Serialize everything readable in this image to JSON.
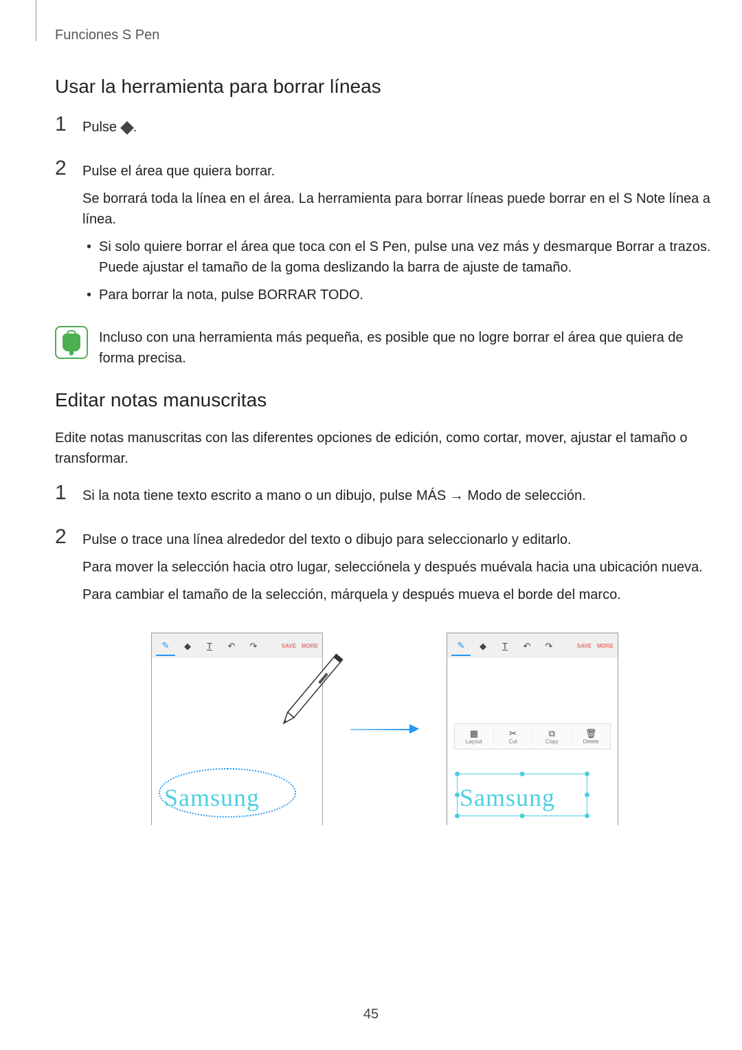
{
  "header": {
    "breadcrumb": "Funciones S Pen"
  },
  "section1": {
    "title": "Usar la herramienta para borrar líneas",
    "step1": {
      "text_prefix": "Pulse ",
      "text_suffix": "."
    },
    "step2": {
      "line1": "Pulse el área que quiera borrar.",
      "line2": "Se borrará toda la línea en el área. La herramienta para borrar líneas puede borrar en el S Note línea a línea.",
      "bullet1": "Si solo quiere borrar el área que toca con el S Pen, pulse una vez más y desmarque Borrar a trazos. Puede ajustar el tamaño de la goma deslizando la barra de ajuste de tamaño.",
      "bullet2": "Para borrar la nota, pulse BORRAR TODO."
    },
    "note": "Incluso con una herramienta más pequeña, es posible que no logre borrar el área que quiera de forma precisa."
  },
  "section2": {
    "title": "Editar notas manuscritas",
    "intro": "Edite notas manuscritas con las diferentes opciones de edición, como cortar, mover, ajustar el tamaño o transformar.",
    "step1": {
      "prefix": "Si la nota tiene texto escrito a mano o un dibujo, pulse ",
      "mas": "MÁS",
      "arrow": " → ",
      "mode": "Modo de selección",
      "suffix": "."
    },
    "step2": {
      "line1": "Pulse o trace una línea alrededor del texto o dibujo para seleccionarlo y editarlo.",
      "line2": "Para mover la selección hacia otro lugar, selecciónela y después muévala hacia una ubicación nueva.",
      "line3": "Para cambiar el tamaño de la selección, márquela y después mueva el borde del marco."
    }
  },
  "illustration": {
    "toolbar": {
      "pen": "Pen",
      "eraser": "Eraser",
      "text": "T",
      "undo": "Undo",
      "redo": "Redo",
      "save": "SAVE",
      "more": "MORE"
    },
    "context": {
      "layout": "Layout",
      "cut": "Cut",
      "copy": "Copy",
      "delete": "Delete"
    },
    "handwriting": "Samsung"
  },
  "page_number": "45"
}
